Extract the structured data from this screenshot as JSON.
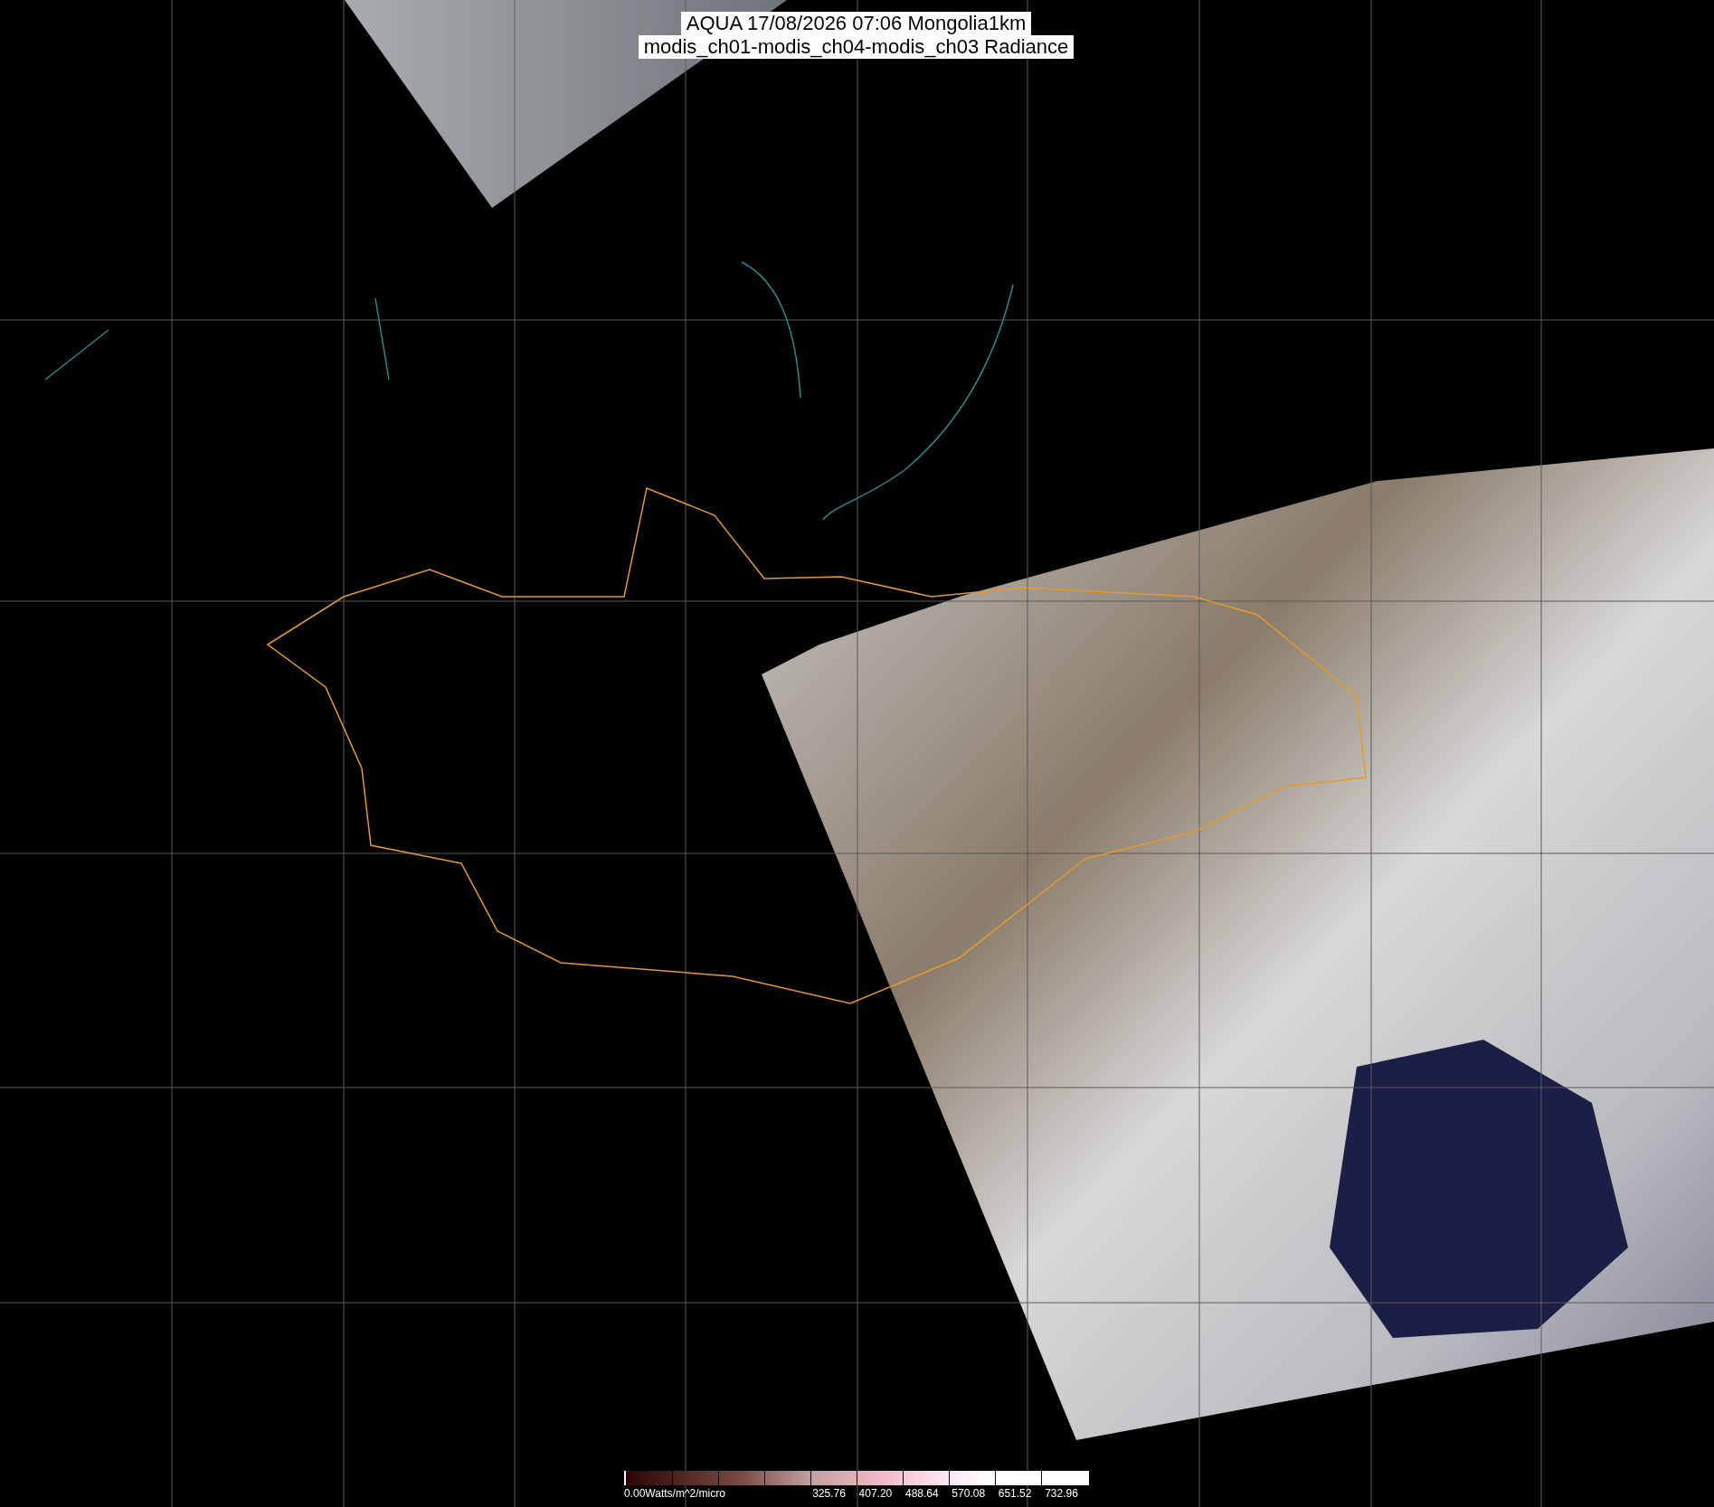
{
  "title": {
    "lines": [
      "AQUA 17/08/2026 07:06 Mongolia1km",
      "modis_ch01-modis_ch04-modis_ch03 Radiance"
    ]
  },
  "colorbar": {
    "labels": [
      "0.00Watts/m^2/micro",
      "325.76",
      "407.20",
      "488.64",
      "570.08",
      "651.52",
      "732.96"
    ]
  }
}
